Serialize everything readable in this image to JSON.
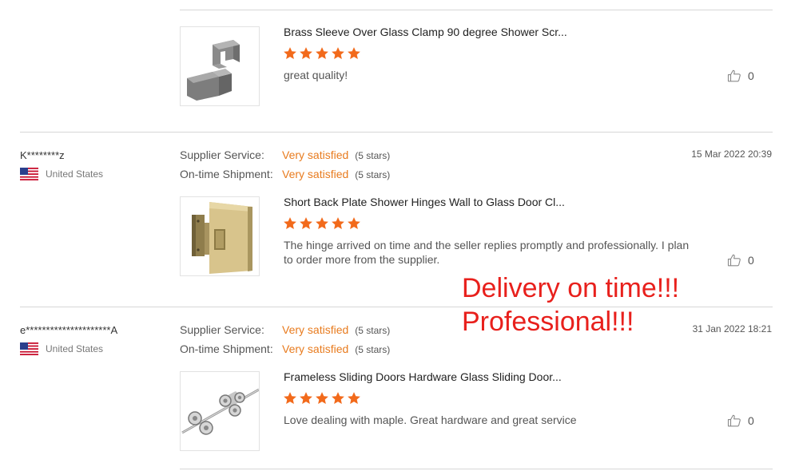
{
  "reviews": [
    {
      "product": {
        "title": "Brass Sleeve Over Glass Clamp 90 degree Shower Scr...",
        "image_icon": "glass-clamp-image"
      },
      "stars": 5,
      "text": "great quality!",
      "likes": "0"
    },
    {
      "reviewer": {
        "name": "K********z",
        "country": "United States"
      },
      "supplier_service": {
        "label": "Supplier Service:",
        "value": "Very satisfied",
        "stars": "(5 stars)"
      },
      "ontime_shipment": {
        "label": "On-time Shipment:",
        "value": "Very satisfied",
        "stars": "(5 stars)"
      },
      "date": "15 Mar 2022 20:39",
      "product": {
        "title": "Short Back Plate Shower Hinges Wall to Glass Door Cl...",
        "image_icon": "shower-hinge-image"
      },
      "stars": 5,
      "text_line1": "The hinge arrived on time and the seller replies promptly and professionally. I plan",
      "text_line2": "to order more from the supplier.",
      "likes": "0"
    },
    {
      "reviewer": {
        "name": "e*********************A",
        "country": "United States"
      },
      "supplier_service": {
        "label": "Supplier Service:",
        "value": "Very satisfied",
        "stars": "(5 stars)"
      },
      "ontime_shipment": {
        "label": "On-time Shipment:",
        "value": "Very satisfied",
        "stars": "(5 stars)"
      },
      "date": "31 Jan 2022 18:21",
      "product": {
        "title": "Frameless Sliding Doors Hardware Glass Sliding Door...",
        "image_icon": "sliding-door-hardware-image"
      },
      "stars": 5,
      "text": "Love dealing with maple. Great hardware and great service",
      "likes": "0"
    }
  ],
  "overlay": {
    "line1": "Delivery on time!!!",
    "line2": "Professional!!!"
  },
  "colors": {
    "star": "#f26a1b",
    "rating_value": "#e87b1e",
    "overlay_text": "#e8201c",
    "divider": "#d6d6d6"
  },
  "icons": {
    "star": "star-icon",
    "like": "thumbs-up-icon",
    "flag": "us-flag-icon"
  }
}
